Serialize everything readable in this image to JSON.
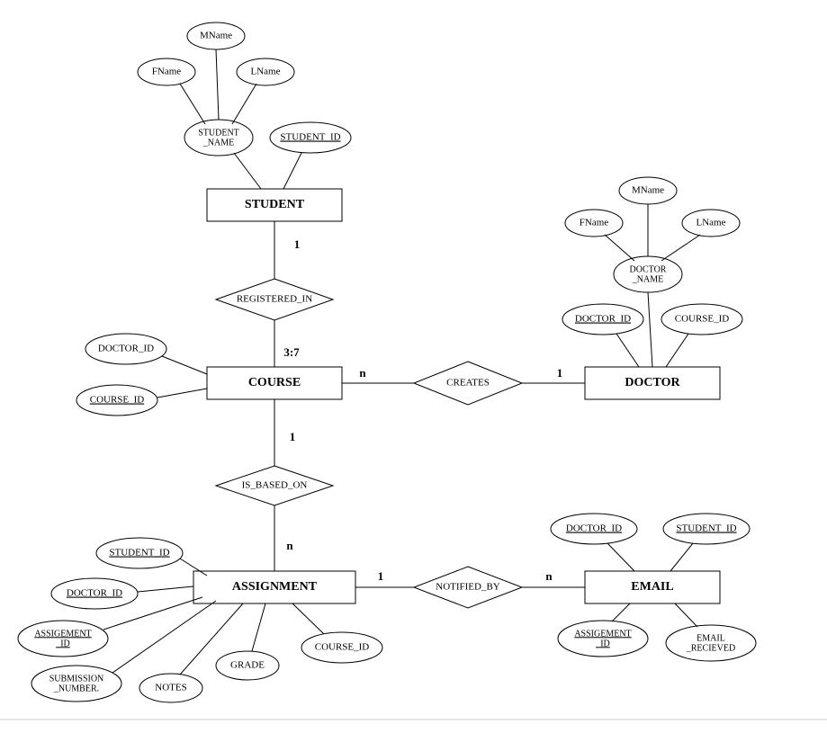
{
  "entities": {
    "student": "STUDENT",
    "course": "COURSE",
    "doctor": "DOCTOR",
    "assignment": "ASSIGNMENT",
    "email": "EMAIL"
  },
  "relationships": {
    "registered_in": "REGISTERED_IN",
    "creates": "CREATES",
    "is_based_on": "IS_BASED_ON",
    "notified_by": "NOTIFIED_BY"
  },
  "attributes": {
    "student": {
      "mname": "MName",
      "fname": "FName",
      "lname": "LName",
      "student_name_1": "STUDENT",
      "student_name_2": "_NAME",
      "student_id": "STUDENT_ID"
    },
    "course": {
      "doctor_id": "DOCTOR_ID",
      "course_id": "COURSE_ID"
    },
    "doctor": {
      "mname": "MName",
      "fname": "FName",
      "lname": "LName",
      "doctor_name_1": "DOCTOR",
      "doctor_name_2": "_NAME",
      "doctor_id": "DOCTOR_ID",
      "course_id": "COURSE_ID"
    },
    "assignment": {
      "student_id": "STUDENT_ID",
      "doctor_id": "DOCTOR_ID",
      "assignment_id_1": "ASSIGEMENT",
      "assignment_id_2": "_ID",
      "submission_number_1": "SUBMISSION",
      "submission_number_2": "_NUMBER.",
      "notes": "NOTES",
      "grade": "GRADE",
      "course_id": "COURSE_ID"
    },
    "email": {
      "doctor_id": "DOCTOR_ID",
      "student_id": "STUDENT_ID",
      "assignment_id_1": "ASSIGEMENT",
      "assignment_id_2": "_ID",
      "email_received_1": "EMAIL",
      "email_received_2": "_RECIEVED"
    }
  },
  "cardinalities": {
    "student_registered": "1",
    "registered_course": "3:7",
    "course_creates": "n",
    "creates_doctor": "1",
    "course_isbased": "1",
    "isbased_assignment": "n",
    "assignment_notified": "1",
    "notified_email": "n"
  }
}
